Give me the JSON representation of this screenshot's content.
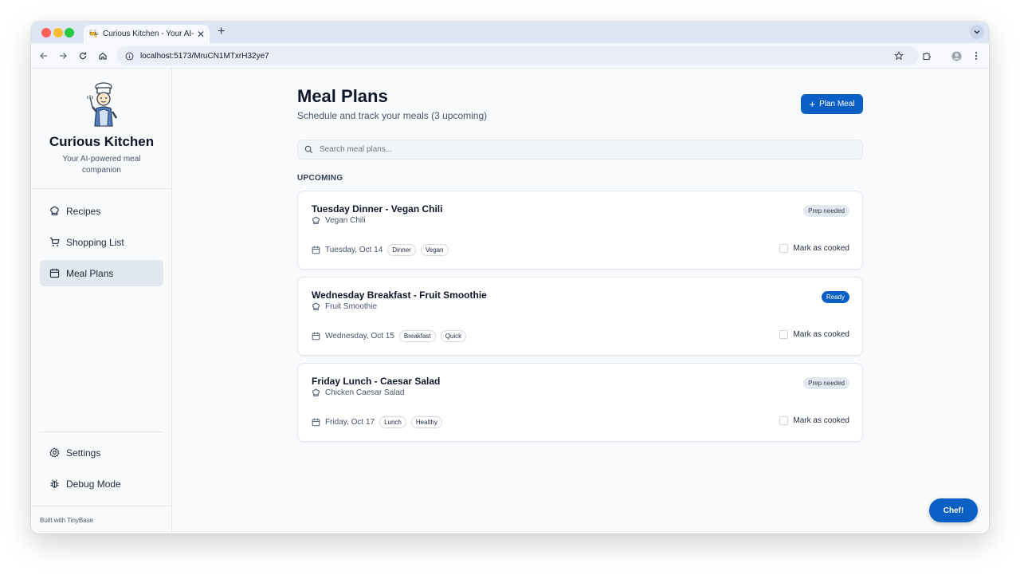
{
  "browser": {
    "tab_title": "Curious Kitchen - Your AI-po",
    "url": "localhost:5173/MruCN1MTxrH32ye7"
  },
  "sidebar": {
    "brand_name": "Curious Kitchen",
    "brand_tagline": "Your AI-powered meal companion",
    "nav": [
      {
        "label": "Recipes",
        "icon": "chef-hat-icon"
      },
      {
        "label": "Shopping List",
        "icon": "cart-icon"
      },
      {
        "label": "Meal Plans",
        "icon": "calendar-icon",
        "active": true
      }
    ],
    "bottom_nav": [
      {
        "label": "Settings",
        "icon": "gear-icon"
      },
      {
        "label": "Debug Mode",
        "icon": "bug-icon"
      }
    ],
    "footer": "Built with TinyBase"
  },
  "main": {
    "title": "Meal Plans",
    "subtitle": "Schedule and track your meals (3 upcoming)",
    "plan_button": "Plan Meal",
    "search_placeholder": "Search meal plans...",
    "section_label": "UPCOMING",
    "cards": [
      {
        "title": "Tuesday Dinner - Vegan Chili",
        "recipe": "Vegan Chili",
        "status": "Prep needed",
        "date": "Tuesday, Oct 14",
        "tags": [
          "Dinner",
          "Vegan"
        ],
        "action": "Mark as cooked"
      },
      {
        "title": "Wednesday Breakfast - Fruit Smoothie",
        "recipe": "Fruit Smoothie",
        "status": "Ready",
        "date": "Wednesday, Oct 15",
        "tags": [
          "Breakfast",
          "Quick"
        ],
        "action": "Mark as cooked"
      },
      {
        "title": "Friday Lunch - Caesar Salad",
        "recipe": "Chicken Caesar Salad",
        "status": "Prep needed",
        "date": "Friday, Oct 17",
        "tags": [
          "Lunch",
          "Healthy"
        ],
        "action": "Mark as cooked"
      }
    ],
    "chef_button": "Chef!"
  },
  "colors": {
    "accent": "#0a5fc4",
    "sidebar_bg": "#f8fafc",
    "active_nav_bg": "#e2e8f0"
  }
}
